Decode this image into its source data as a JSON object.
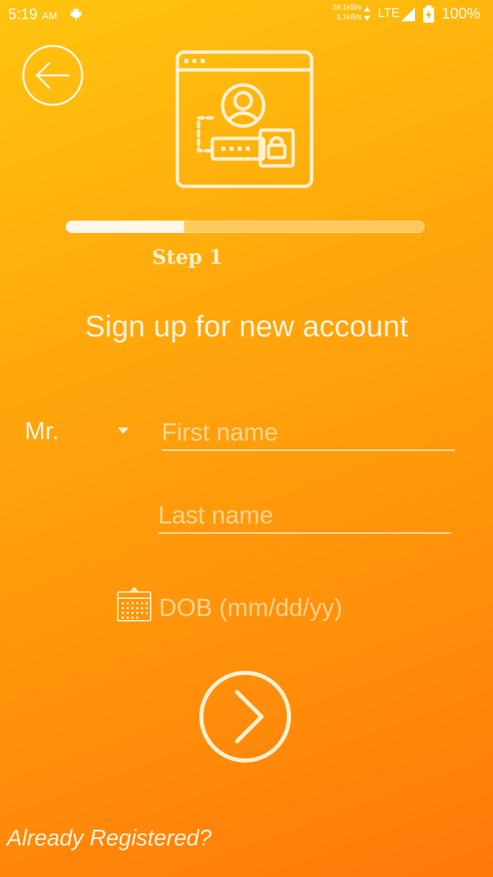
{
  "status_bar": {
    "time": "5:19",
    "ampm": "AM",
    "net_up": "39.1kB/s",
    "net_down": "1.1kB/s",
    "network": "LTE",
    "battery": "100%",
    "icons": [
      "maple-leaf-icon",
      "data-arrows-icon",
      "signal-icon",
      "battery-charging-icon"
    ]
  },
  "header": {
    "back_icon": "arrow-left-icon",
    "hero_icon": "browser-user-login-icon"
  },
  "progress": {
    "value": 0.33,
    "step_label": "Step 1"
  },
  "form": {
    "title": "Sign up for new account",
    "salutation": "Mr.",
    "first_name_placeholder": "First name",
    "last_name_placeholder": "Last name",
    "dob_placeholder": "DOB (mm/dd/yy)",
    "dob_icon": "calendar-icon",
    "next_icon": "chevron-right-icon"
  },
  "footer": {
    "already_registered": "Already Registered?"
  },
  "colors": {
    "gradient_top": "#ffc40f",
    "gradient_bottom": "#ff780a",
    "foreground": "#fff3dc"
  }
}
